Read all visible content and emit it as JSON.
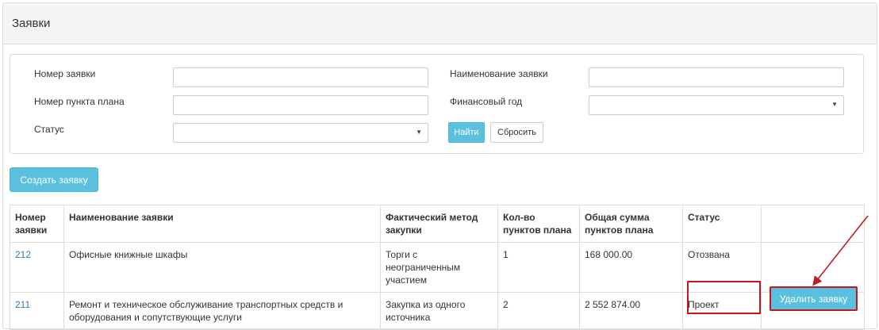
{
  "panel": {
    "title": "Заявки"
  },
  "filters": {
    "number_label": "Номер заявки",
    "name_label": "Наименование заявки",
    "plan_item_label": "Номер пункта плана",
    "fin_year_label": "Финансовый год",
    "status_label": "Статус",
    "number_value": "",
    "name_value": "",
    "plan_item_value": "",
    "fin_year_value": "",
    "status_value": "",
    "find_label": "Найти",
    "reset_label": "Сбросить"
  },
  "create_button": "Создать заявку",
  "table": {
    "headers": [
      "Номер заявки",
      "Наименование заявки",
      "Фактический метод закупки",
      "Кол-во пунктов плана",
      "Общая сумма пунктов плана",
      "Статус",
      ""
    ],
    "rows": [
      {
        "number": "212",
        "name": "Офисные книжные шкафы",
        "method": "Торги с неограниченным участием",
        "count": "1",
        "sum": "168 000.00",
        "status": "Отозвана"
      },
      {
        "number": "211",
        "name": "Ремонт и техническое обслуживание транспортных средств и оборудования и сопутствующие услуги",
        "method": "Закупка из одного источника",
        "count": "2",
        "sum": "2 552 874.00",
        "status": "Проект",
        "action": "Удалить заявку"
      }
    ]
  },
  "colors": {
    "accent": "#5bc0de",
    "link": "#337ab7",
    "annotation": "#c0181f"
  },
  "icons": {
    "select_caret": "caret-down-icon"
  }
}
